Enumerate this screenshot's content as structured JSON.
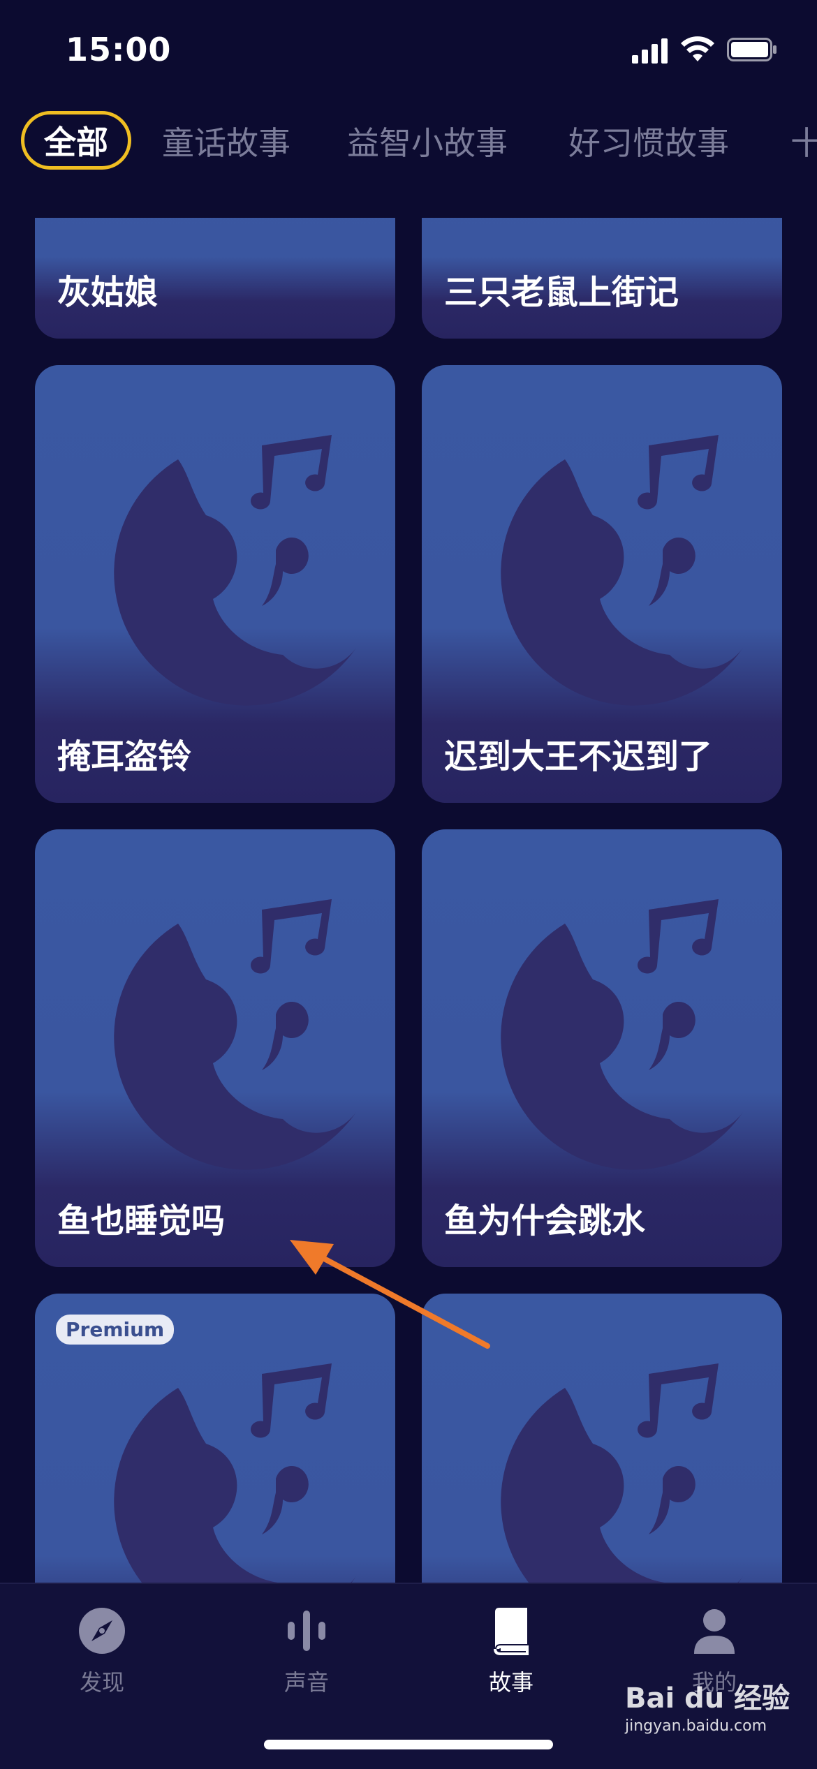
{
  "status_bar": {
    "time": "15:00"
  },
  "tabs": [
    {
      "label": "全部",
      "active": true
    },
    {
      "label": "童话故事"
    },
    {
      "label": "益智小故事"
    },
    {
      "label": "好习惯故事"
    },
    {
      "label": "十"
    }
  ],
  "stories": [
    {
      "title": "灰姑娘"
    },
    {
      "title": "三只老鼠上街记"
    },
    {
      "title": "掩耳盗铃"
    },
    {
      "title": "迟到大王不迟到了"
    },
    {
      "title": "鱼也睡觉吗"
    },
    {
      "title": "鱼为什会跳水"
    },
    {
      "title": "",
      "badge": "Premium"
    },
    {
      "title": ""
    }
  ],
  "nav": [
    {
      "label": "发现",
      "icon": "compass-icon"
    },
    {
      "label": "声音",
      "icon": "sound-wave-icon"
    },
    {
      "label": "故事",
      "icon": "book-icon",
      "active": true
    },
    {
      "label": "我的",
      "icon": "user-icon"
    }
  ],
  "watermark": {
    "brand": "Bai du 经验",
    "url": "jingyan.baidu.com"
  },
  "colors": {
    "accent_tab_border": "#f0be22",
    "background": "#0c0b30",
    "card": "#3a58a2",
    "arrow": "#f07a2a"
  }
}
